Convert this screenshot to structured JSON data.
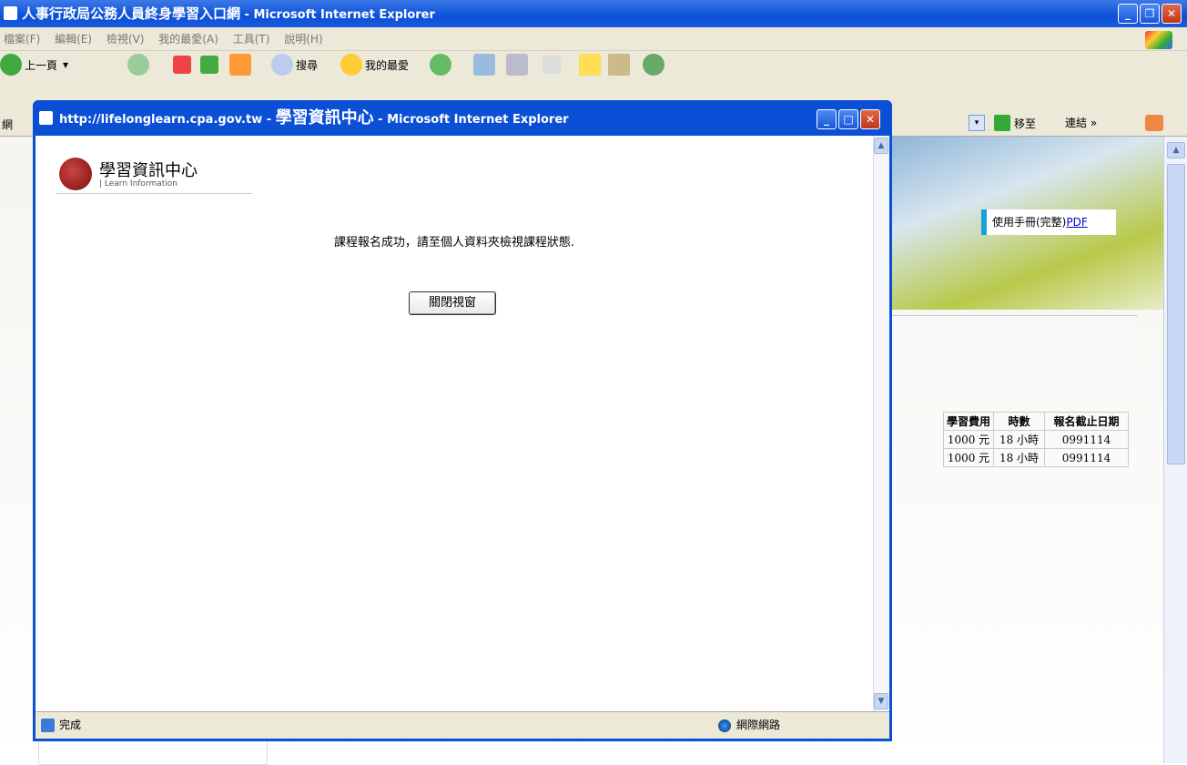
{
  "main_window": {
    "title": "人事行政局公務人員終身學習入口網",
    "title_suffix": " - Microsoft Internet Explorer",
    "menu": [
      "檔案(F)",
      "編輯(E)",
      "檢視(V)",
      "我的最愛(A)",
      "工具(T)",
      "說明(H)"
    ],
    "toolbar": {
      "back": "上一頁",
      "search": "搜尋",
      "favorites": "我的最愛"
    },
    "address_label": "網",
    "go_label": "移至",
    "links_label": "連結",
    "links_chevron": "»"
  },
  "background_page": {
    "manual_text": "使用手冊(完整)",
    "manual_link": "PDF",
    "table": {
      "headers": [
        "學習費用",
        "時數",
        "報名截止日期"
      ],
      "rows": [
        [
          "1000 元",
          "18 小時",
          "0991114"
        ],
        [
          "1000 元",
          "18 小時",
          "0991114"
        ]
      ]
    }
  },
  "popup": {
    "title_url": "http://lifelonglearn.cpa.gov.tw",
    "title_sep": " - ",
    "title_name": "學習資訊中心",
    "title_suffix": " - Microsoft Internet Explorer",
    "logo_title": "學習資訊中心",
    "logo_subtitle": "| Learn Information",
    "message": "課程報名成功，請至個人資料夾檢視課程狀態.",
    "close_button": "關閉視窗",
    "status_done": "完成",
    "status_zone": "網際網路"
  },
  "colors": {
    "title_bar": "#0a4fd6",
    "accent_link": "#0000cc",
    "manual_border": "#1aa0d8"
  }
}
